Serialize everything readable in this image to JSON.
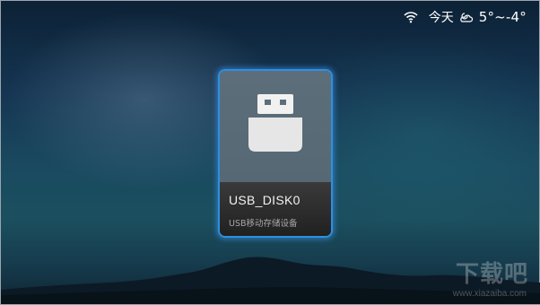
{
  "status_bar": {
    "wifi_icon": "wifi-icon",
    "day_label": "今天",
    "weather_icon": "cloudy-night-icon",
    "temperature": "5°~-4°"
  },
  "device_card": {
    "icon": "usb-drive-icon",
    "name": "USB_DISK0",
    "description": "USB移动存储设备",
    "focus_color": "#2f8fe0"
  },
  "watermark": {
    "text": "下载吧",
    "url": "www.xiazaiba.com"
  }
}
